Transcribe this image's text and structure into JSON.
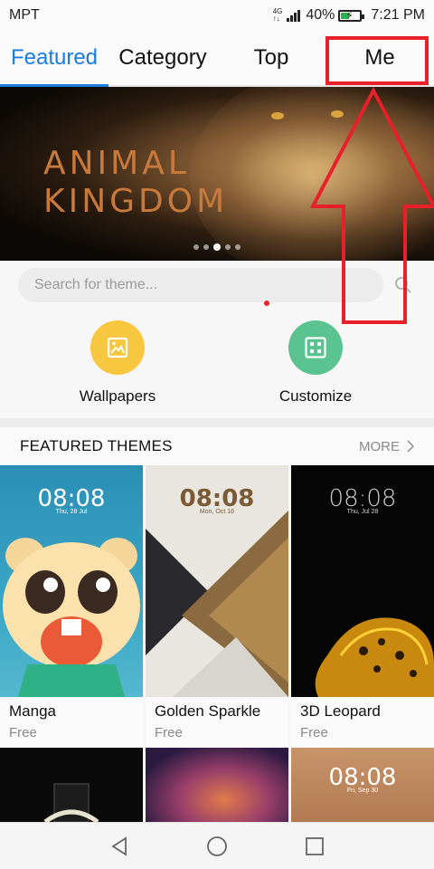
{
  "status_bar": {
    "carrier": "MPT",
    "network_top": "4G",
    "network_bottom": "↑↓",
    "battery": "40%",
    "time": "7:21 PM"
  },
  "tabs": [
    {
      "label": "Featured",
      "active": true
    },
    {
      "label": "Category",
      "active": false
    },
    {
      "label": "Top",
      "active": false
    },
    {
      "label": "Me",
      "active": false
    }
  ],
  "banner": {
    "line1": "ANIMAL",
    "line2": "KINGDOM",
    "page_count": 5,
    "current_page": 3
  },
  "search": {
    "placeholder": "Search for theme..."
  },
  "quick_actions": [
    {
      "label": "Wallpapers",
      "icon": "image-icon",
      "color": "#f7c73f"
    },
    {
      "label": "Customize",
      "icon": "grid-icon",
      "color": "#5bc38f"
    }
  ],
  "featured": {
    "title": "FEATURED THEMES",
    "more": "MORE",
    "themes": [
      {
        "name": "Manga",
        "price": "Free",
        "clock": "08:08",
        "date": "Thu, 28 Jul"
      },
      {
        "name": "Golden Sparkle",
        "price": "Free",
        "clock": "08:08",
        "date": "Mon, Oct 16"
      },
      {
        "name": "3D Leopard",
        "price": "Free",
        "clock": "08:08",
        "date": "Thu, Jul 28"
      }
    ],
    "next_row": [
      {
        "name": "watch-theme"
      },
      {
        "name": "nebula-theme"
      },
      {
        "clock": "08:08",
        "date": "Fri, Sep 30"
      }
    ]
  },
  "colors": {
    "accent": "#1a7ce0",
    "annotation": "#e8202a"
  },
  "navbar": {
    "icons": [
      "back-icon",
      "home-icon",
      "recents-icon"
    ]
  }
}
